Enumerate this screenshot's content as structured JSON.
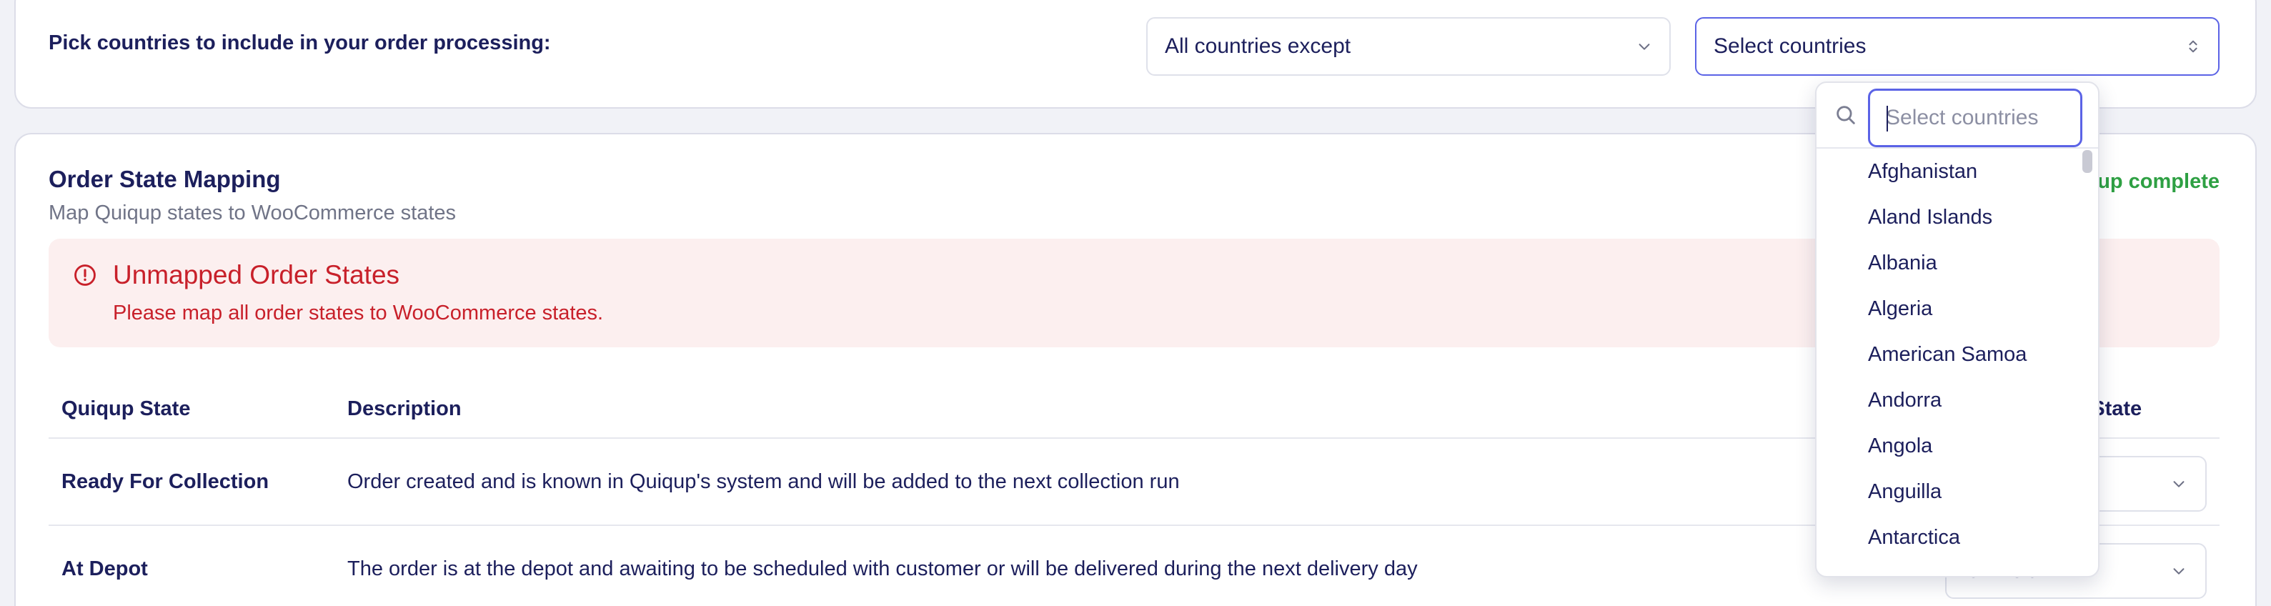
{
  "countries": {
    "label": "Pick countries to include in your order processing:",
    "mode_select": {
      "value": "All countries except"
    },
    "country_select": {
      "value": "Select countries"
    }
  },
  "order_state_mapping": {
    "title": "Order State Mapping",
    "subtitle": "Map Quiqup states to WooCommerce states",
    "setup_status": "Setup complete",
    "alert": {
      "title": "Unmapped Order States",
      "text": "Please map all order states to WooCommerce states."
    },
    "table": {
      "headers": [
        "Quiqup State",
        "Description",
        "WooCommerce State"
      ],
      "rows": [
        {
          "state": "Ready For Collection",
          "description": "Order created and is known in Quiqup's system and will be added to the next collection run",
          "woo_state": ""
        },
        {
          "state": "At Depot",
          "description": "The order is at the depot and awaiting to be scheduled with customer or will be delivered during the next delivery day",
          "woo_state": "On-hold"
        }
      ]
    }
  },
  "dropdown": {
    "search_placeholder": "Select countries",
    "options": [
      "Afghanistan",
      "Aland Islands",
      "Albania",
      "Algeria",
      "American Samoa",
      "Andorra",
      "Angola",
      "Anguilla",
      "Antarctica"
    ]
  },
  "colors": {
    "accent": "#5b63e6",
    "error": "#c8202a",
    "error_bg": "#fcefef",
    "success": "#2ea043",
    "text": "#1c1f5c"
  }
}
